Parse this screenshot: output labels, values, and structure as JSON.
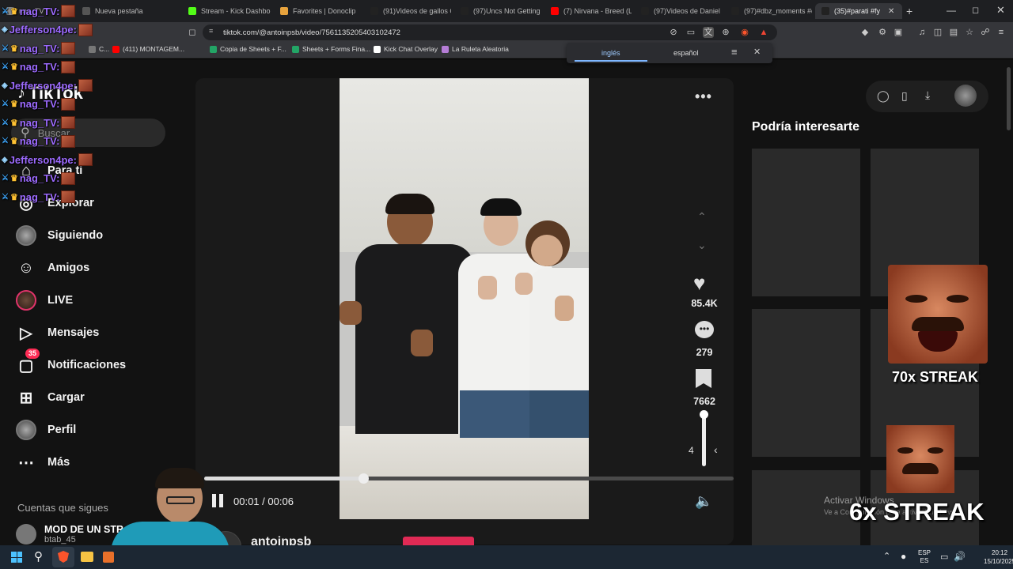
{
  "tabs": [
    {
      "label": "nag_TV",
      "fav": "#8a8a8a"
    },
    {
      "label": "Nueva pestaña",
      "fav": "#555"
    },
    {
      "label": "Stream - Kick Dashbo",
      "fav": "#53fc18"
    },
    {
      "label": "Favorites | Donoclip",
      "fav": "#e8a33d"
    },
    {
      "label": "(91)Videos de gallos G",
      "fav": "#222"
    },
    {
      "label": "(97)Uncs Not Getting a",
      "fav": "#222"
    },
    {
      "label": "(7) Nirvana - Breed (Liv",
      "fav": "#ff0000"
    },
    {
      "label": "(97)Videos de Daniel |",
      "fav": "#222"
    },
    {
      "label": "(97)#dbz_moments #d",
      "fav": "#222"
    },
    {
      "label": "(35)#parati #fy",
      "fav": "#222"
    }
  ],
  "address": {
    "url": "tiktok.com/@antoinpsb/video/7561135205403102472"
  },
  "bookmarks": [
    {
      "label": "C...",
      "fav": "#777"
    },
    {
      "label": "(411) MONTAGEM...",
      "fav": "#ff0000"
    },
    {
      "label": "Copia de Sheets + F...",
      "fav": "#23a566"
    },
    {
      "label": "Sheets + Forms Fina...",
      "fav": "#23a566"
    },
    {
      "label": "Kick Chat Overlay",
      "fav": "#fff"
    },
    {
      "label": "La Ruleta Aleatoria",
      "fav": "#b57dd6"
    }
  ],
  "translate": {
    "lang_from": "inglés",
    "lang_to": "español"
  },
  "tiktok": {
    "logo": "TikTok",
    "search_placeholder": "Buscar",
    "nav": [
      {
        "label": "Para ti",
        "icon": "home-icon"
      },
      {
        "label": "Explorar",
        "icon": "compass-icon"
      },
      {
        "label": "Siguiendo",
        "icon": "following-avatar-icon"
      },
      {
        "label": "Amigos",
        "icon": "friends-icon"
      },
      {
        "label": "LIVE",
        "icon": "live-avatar-icon"
      },
      {
        "label": "Mensajes",
        "icon": "send-icon"
      },
      {
        "label": "Notificaciones",
        "icon": "inbox-icon"
      },
      {
        "label": "Cargar",
        "icon": "plus-square-icon"
      },
      {
        "label": "Perfil",
        "icon": "profile-avatar-icon"
      },
      {
        "label": "Más",
        "icon": "more-icon"
      }
    ],
    "notif_badge": "35",
    "following_heading": "Cuentas que sigues",
    "following_account": {
      "name": "MOD DE UN STR",
      "handle": "btab_45"
    },
    "recs_heading": "Podría interesarte",
    "video": {
      "likes": "85.4K",
      "comments": "279",
      "saves": "7662",
      "time_current": "00:01",
      "time_total": "00:06",
      "progress": 0.3,
      "volume_value": "4",
      "volume_level": 0.95,
      "author": "antoinpsb"
    }
  },
  "chat": [
    {
      "user": "nag_TV:",
      "color": "#9d6bff"
    },
    {
      "user": "Jefferson4pe:",
      "color": "#9d6bff"
    },
    {
      "user": "nag_TV:",
      "color": "#9d6bff"
    },
    {
      "user": "nag_TV:",
      "color": "#9d6bff"
    },
    {
      "user": "Jefferson4pe:",
      "color": "#9d6bff"
    },
    {
      "user": "nag_TV:",
      "color": "#9d6bff"
    },
    {
      "user": "nag_TV:",
      "color": "#9d6bff"
    },
    {
      "user": "nag_TV:",
      "color": "#9d6bff"
    },
    {
      "user": "Jefferson4pe:",
      "color": "#9d6bff"
    },
    {
      "user": "nag_TV:",
      "color": "#9d6bff"
    },
    {
      "user": "nag_TV:",
      "color": "#9d6bff"
    }
  ],
  "streaks": {
    "big": "70x STREAK",
    "small": "6x STREAK"
  },
  "watermark": {
    "line1": "Activar Windows",
    "line2": "Ve a Configuración para activar Windows."
  },
  "taskbar": {
    "lang1": "ESP",
    "lang2": "ES",
    "time": "20:12",
    "date": "15/10/2025"
  }
}
